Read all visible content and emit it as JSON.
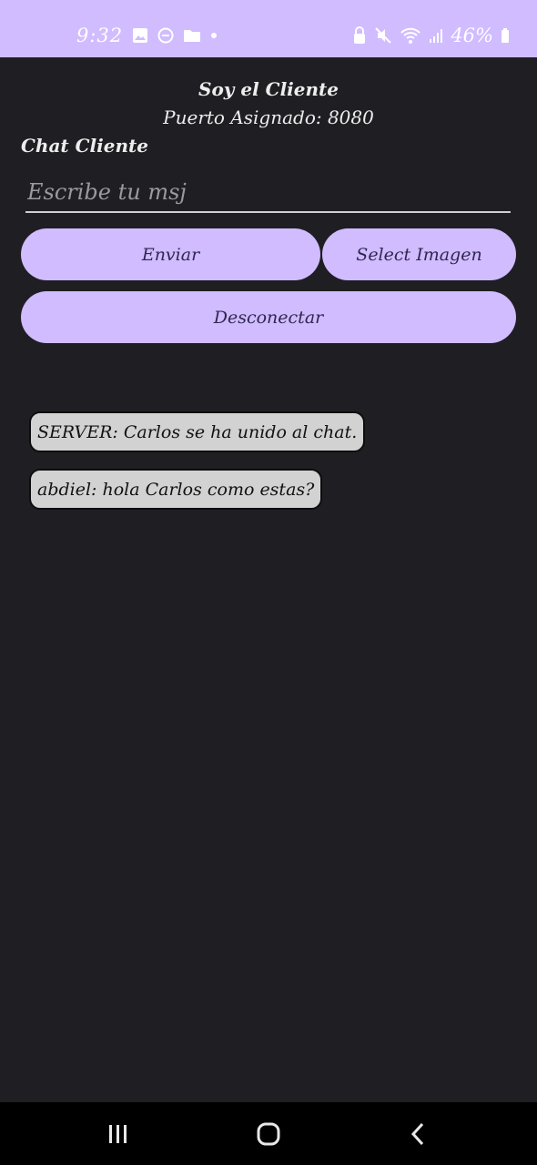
{
  "status_bar": {
    "time": "9:32",
    "battery": "46%",
    "bg_color": "#d0bcff",
    "left_icons": [
      "image-icon",
      "dnd-icon",
      "folder-icon",
      "dot-icon"
    ],
    "right_icons": [
      "lock-icon",
      "mute-icon",
      "wifi-icon",
      "signal-icon",
      "battery-icon"
    ]
  },
  "header": {
    "title": "Soy el Cliente",
    "port": "Puerto Asignado: 8080"
  },
  "chat_label": "Chat Cliente",
  "input": {
    "placeholder": "Escribe tu msj",
    "value": ""
  },
  "buttons": {
    "send": "Enviar",
    "select_image": "Select Imagen",
    "disconnect": "Desconectar",
    "color": "#d0bcff"
  },
  "messages": [
    {
      "text": "SERVER: Carlos se ha unido al chat."
    },
    {
      "text": "abdiel: hola Carlos como estas?"
    }
  ],
  "nav_bar": {
    "icons": [
      "recents-icon",
      "home-icon",
      "back-icon"
    ]
  }
}
